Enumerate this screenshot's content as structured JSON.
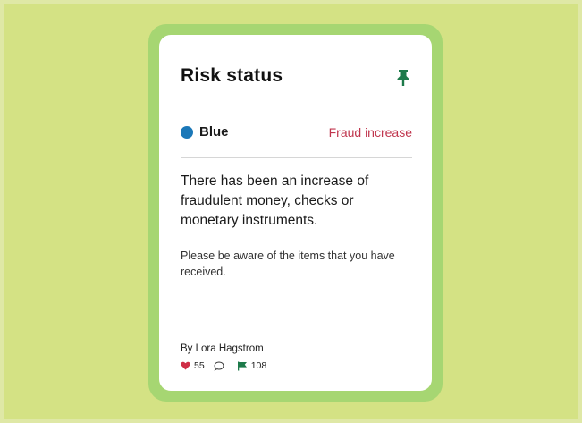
{
  "card": {
    "title": "Risk status",
    "status_level": "Blue",
    "status_color": "#1b78b8",
    "risk_type": "Fraud increase",
    "risk_type_color": "#c0364e",
    "headline": "There has been an increase of fraudulent money, checks or monetary instruments.",
    "body": "Please be aware of the items that you have received.",
    "author": "By Lora Hagstrom",
    "likes": "55",
    "flags": "108",
    "icons": [
      "pin-icon",
      "heart-icon",
      "comment-icon",
      "flag-icon"
    ],
    "accent_color": "#1d7a4a",
    "frame_color": "#a6d672",
    "background_color": "#d4e284"
  }
}
